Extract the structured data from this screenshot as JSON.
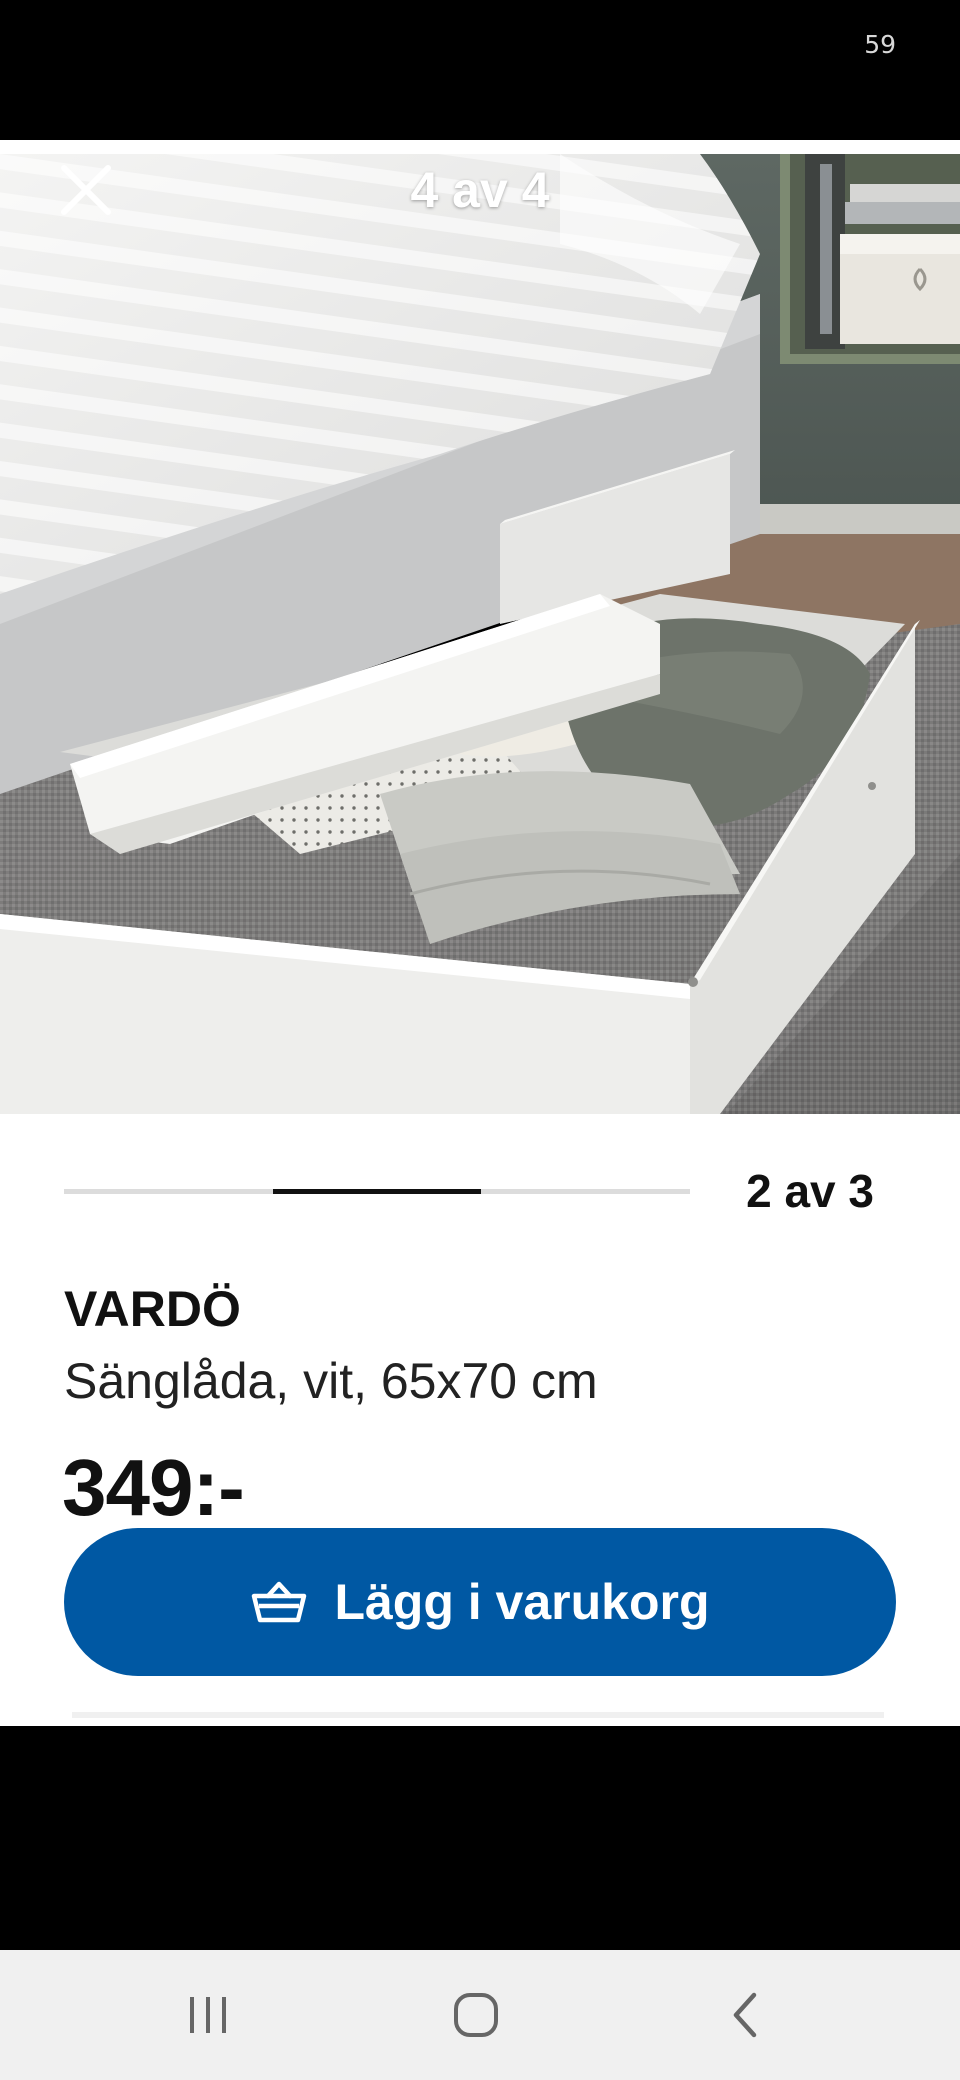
{
  "status_bar": {
    "text": "59"
  },
  "viewer": {
    "counter": "4 av 4",
    "close_icon": "close-icon"
  },
  "product": {
    "image_counter": "2 av 3",
    "image_progress": {
      "current": 2,
      "total": 3
    },
    "name": "VARDÖ",
    "description": "Sänglåda, vit, 65x70 cm",
    "price": "349:-",
    "add_to_cart_label": "Lägg i varukorg",
    "add_to_cart_icon": "shopping-basket-icon"
  },
  "colors": {
    "brand_blue": "#0058a3",
    "progress_track": "#dcdcdc",
    "progress_fill": "#111111"
  },
  "nav_bar": {
    "recents_icon": "recent-apps-icon",
    "home_icon": "home-icon",
    "back_icon": "back-icon"
  }
}
